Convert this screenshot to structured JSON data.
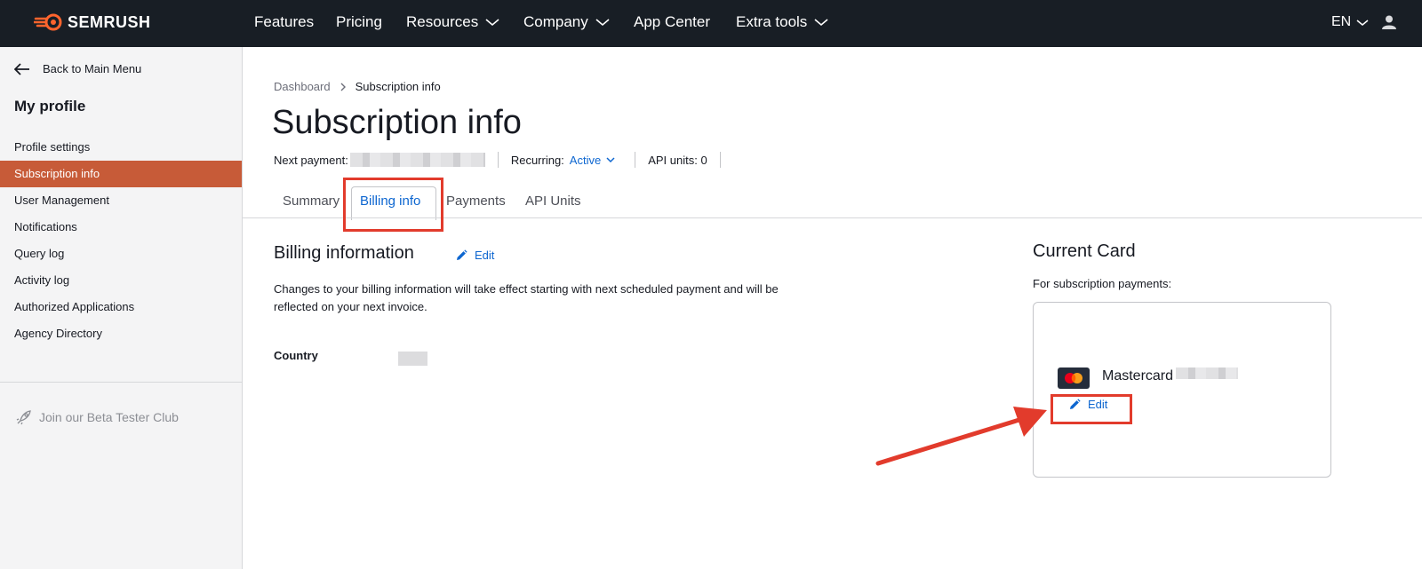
{
  "brand": {
    "name": "SEMRUSH",
    "accent": "#ff642d"
  },
  "topnav": {
    "items": [
      {
        "label": "Features",
        "dropdown": false
      },
      {
        "label": "Pricing",
        "dropdown": false
      },
      {
        "label": "Resources",
        "dropdown": true
      },
      {
        "label": "Company",
        "dropdown": true
      },
      {
        "label": "App Center",
        "dropdown": false
      },
      {
        "label": "Extra tools",
        "dropdown": true
      }
    ],
    "language": "EN"
  },
  "sidebar": {
    "back_label": "Back to Main Menu",
    "title": "My profile",
    "items": [
      {
        "label": "Profile settings",
        "active": false
      },
      {
        "label": "Subscription info",
        "active": true
      },
      {
        "label": "User Management",
        "active": false
      },
      {
        "label": "Notifications",
        "active": false
      },
      {
        "label": "Query log",
        "active": false
      },
      {
        "label": "Activity log",
        "active": false
      },
      {
        "label": "Authorized Applications",
        "active": false
      },
      {
        "label": "Agency Directory",
        "active": false
      }
    ],
    "beta_label": "Join our Beta Tester Club"
  },
  "breadcrumb": {
    "parent": "Dashboard",
    "current": "Subscription info"
  },
  "page": {
    "title": "Subscription info",
    "next_payment_label": "Next payment:",
    "recurring_label": "Recurring:",
    "recurring_value": "Active",
    "api_units_label": "API units: 0"
  },
  "tabs": [
    {
      "label": "Summary",
      "selected": false
    },
    {
      "label": "Billing info",
      "selected": true
    },
    {
      "label": "Payments",
      "selected": false
    },
    {
      "label": "API Units",
      "selected": false
    }
  ],
  "billing": {
    "title": "Billing information",
    "edit_label": "Edit",
    "description": "Changes to your billing information will take effect starting with next scheduled payment and will be reflected on your next invoice.",
    "country_label": "Country"
  },
  "card": {
    "title": "Current Card",
    "subtitle": "For subscription payments:",
    "brand": "Mastercard",
    "edit_label": "Edit"
  },
  "colors": {
    "link": "#0d66d0",
    "active_item": "#c75b38",
    "annotation": "#e23b2c"
  }
}
